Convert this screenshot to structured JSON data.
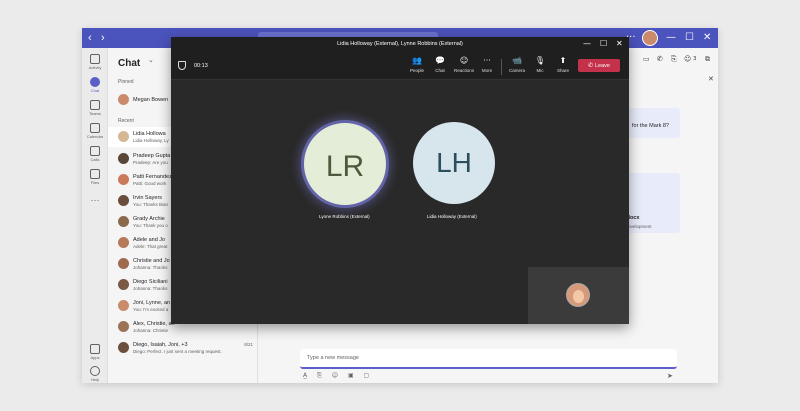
{
  "app": {
    "window_title": "Lidia Holloway (External), Lynne Robbins (External)"
  },
  "titlebar": {
    "nav_back": "‹",
    "nav_forward": "›",
    "controls": [
      "···",
      "—",
      "☐",
      "✕"
    ]
  },
  "rail": [
    {
      "label": "Activity",
      "icon": "bell-icon"
    },
    {
      "label": "Chat",
      "icon": "chat-icon",
      "active": true
    },
    {
      "label": "Teams",
      "icon": "teams-icon"
    },
    {
      "label": "Calendar",
      "icon": "calendar-icon"
    },
    {
      "label": "Calls",
      "icon": "phone-icon"
    },
    {
      "label": "Files",
      "icon": "file-icon"
    },
    {
      "label": "···",
      "icon": "more-icon"
    },
    {
      "label": "Apps",
      "icon": "apps-icon"
    },
    {
      "label": "Help",
      "icon": "help-icon"
    }
  ],
  "chatlist": {
    "title": "Chat",
    "title_chevron": "⌄",
    "pinned_label": "Pinned",
    "recent_label": "Recent",
    "pinned": [
      {
        "name": "Megan Bowen",
        "avatar_color": "#c98b6b"
      }
    ],
    "recent": [
      {
        "name": "Lidia Hollowa",
        "preview": "Lidia Holloway, Ly",
        "avatar_color": "#d4b896"
      },
      {
        "name": "Pradeep Gupta",
        "preview": "Pradeep: Are you",
        "avatar_color": "#5a4636"
      },
      {
        "name": "Patti Fernandez",
        "preview": "Patti: Good work",
        "avatar_color": "#c97b5a"
      },
      {
        "name": "Irvin Sayers",
        "preview": "You: Thanks Bian",
        "avatar_color": "#6b4e3d"
      },
      {
        "name": "Grady Archie",
        "preview": "You: Thank you o",
        "avatar_color": "#8a6a4a"
      },
      {
        "name": "Adele and Jo",
        "preview": "Adele: That great",
        "avatar_color": "#b57a5a"
      },
      {
        "name": "Christie and Jo",
        "preview": "Johanna: Thanks",
        "avatar_color": "#a06a4e"
      },
      {
        "name": "Diego Siciliani",
        "preview": "Johanna: Thanks",
        "avatar_color": "#7a5a44"
      },
      {
        "name": "Joni, Lynne, an",
        "preview": "You: I'm excited a",
        "avatar_color": "#c98b6b"
      },
      {
        "name": "Alex, Christie, an",
        "preview": "Johanna: Christie",
        "avatar_color": "#9b7356"
      },
      {
        "name": "Diego, Isaiah, Joni, +3",
        "preview": "Diego: Perfect. I just sent a meeting request.",
        "time": "8/21",
        "avatar_color": "#6b5040"
      }
    ]
  },
  "main": {
    "header_icons": [
      "video-icon",
      "phone-icon",
      "share-icon",
      "people-icon"
    ],
    "people_count": "3",
    "messages": [
      {
        "text": "for the Mark 8?"
      },
      {
        "file_name": "w.docx",
        "file_sub": "Development"
      }
    ]
  },
  "compose": {
    "placeholder": "Type a new message",
    "tools": [
      "format-icon",
      "attach-icon",
      "emoji-icon",
      "gif-icon",
      "sticker-icon"
    ],
    "send_icon": "send-icon"
  },
  "meeting": {
    "title": "Lidia Holloway (External), Lynne Robbins (External)",
    "timer": "00:13",
    "toolbar": [
      {
        "label": "People",
        "icon": "people-icon",
        "glyph": "👥"
      },
      {
        "label": "Chat",
        "icon": "chat-icon",
        "glyph": "💬"
      },
      {
        "label": "Reactions",
        "icon": "reactions-icon",
        "glyph": "☺"
      },
      {
        "label": "More",
        "icon": "more-icon",
        "glyph": "···"
      },
      {
        "label": "Camera",
        "icon": "camera-icon",
        "glyph": "📹"
      },
      {
        "label": "Mic",
        "icon": "mic-icon",
        "glyph": "🎙"
      },
      {
        "label": "Share",
        "icon": "share-icon",
        "glyph": "⬆"
      }
    ],
    "leave_label": "Leave",
    "participants": [
      {
        "initials": "LR",
        "name": "Lynne Robbins (External)",
        "speaking": true
      },
      {
        "initials": "LH",
        "name": "Lidia Holloway (External)",
        "speaking": false
      }
    ],
    "window_controls": [
      "—",
      "☐",
      "✕"
    ]
  },
  "colors": {
    "teams_purple": "#4b53bc",
    "leave_red": "#c4314b",
    "meeting_bg": "#292929"
  }
}
